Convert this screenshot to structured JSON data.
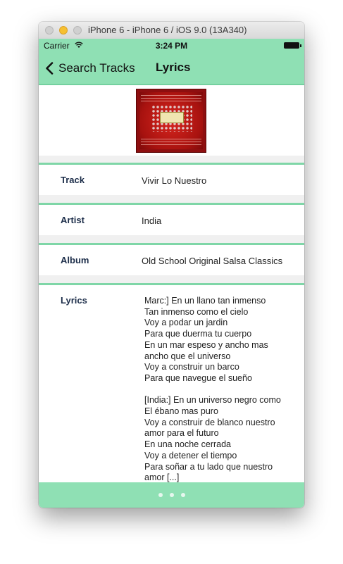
{
  "window": {
    "title": "iPhone 6 - iPhone 6 / iOS 9.0 (13A340)"
  },
  "status_bar": {
    "carrier": "Carrier",
    "time": "3:24 PM",
    "wifi_icon": "wifi-icon",
    "battery_icon": "battery-icon"
  },
  "nav_bar": {
    "back_label": "Search Tracks",
    "title": "Lyrics",
    "back_icon": "chevron-left-icon"
  },
  "details": {
    "album_art_icon": "album-art",
    "track_label": "Track",
    "track_value": "Vivir Lo Nuestro",
    "artist_label": "Artist",
    "artist_value": "India",
    "album_label": "Album",
    "album_value": "Old School Original Salsa Classics",
    "lyrics_label": "Lyrics",
    "lyrics_value": "Marc:] En un llano tan inmenso\nTan inmenso como el cielo\nVoy a podar un jardin\nPara que duerma tu cuerpo\nEn un mar espeso y ancho mas\nancho que el universo\nVoy a construir un barco\nPara que navegue el sueño\n\n[India:] En un universo negro como\nEl ébano mas puro\nVoy a construir de blanco nuestro\namor para el futuro\nEn una noche cerrada\nVoy a detener el tiempo\nPara soñar a tu lado que nuestro\namor [...]"
  },
  "colors": {
    "accent": "#8fe0b4",
    "separator": "#7fd6a7",
    "label_text": "#1d2e4a",
    "background": "#f0f0f0"
  },
  "page_indicator": {
    "count": 3
  }
}
